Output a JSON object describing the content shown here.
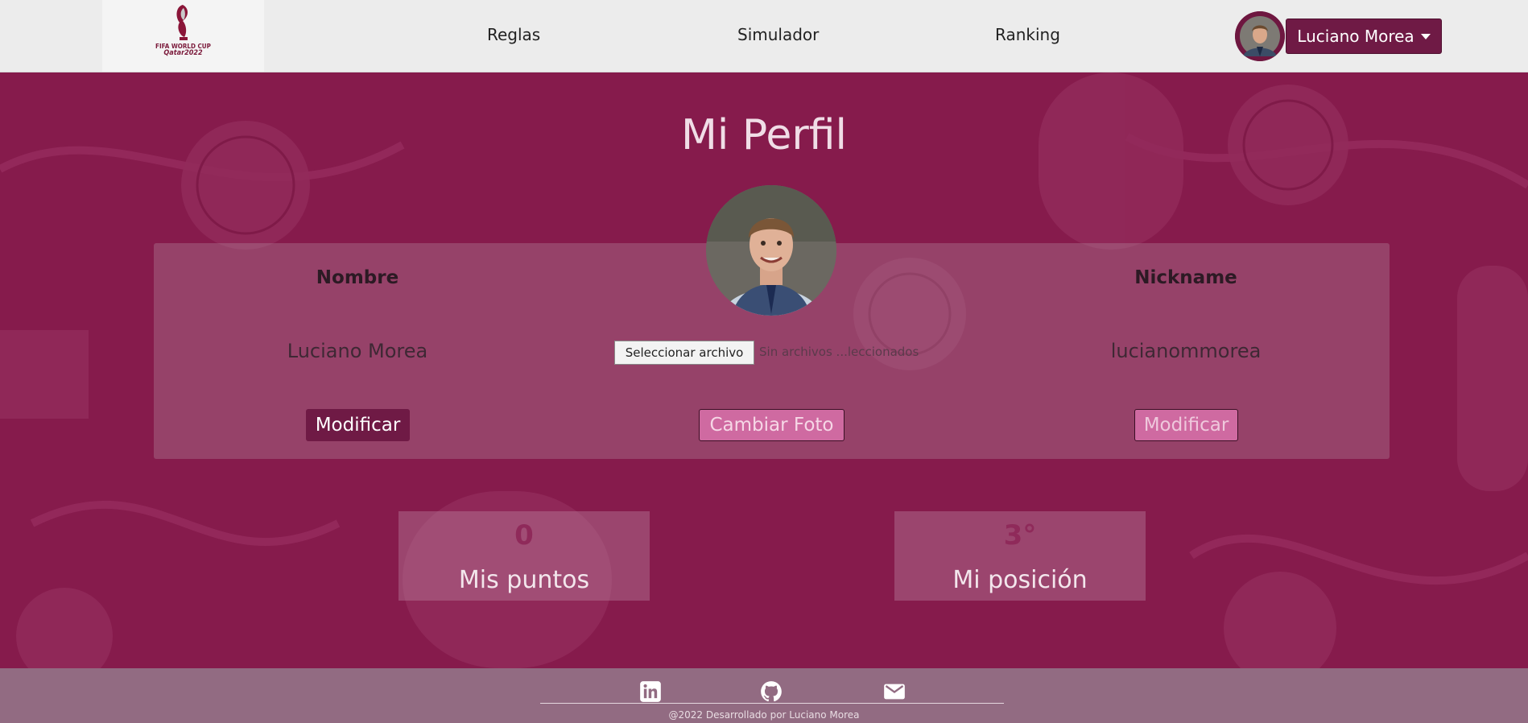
{
  "brand": {
    "logo_text_line1": "FIFA WORLD CUP",
    "logo_text_line2": "Qatar2022",
    "logo_icon": "world-cup-trophy-logo"
  },
  "nav": {
    "links": [
      {
        "label": "Reglas"
      },
      {
        "label": "Simulador"
      },
      {
        "label": "Ranking"
      }
    ],
    "user_name": "Luciano Morea",
    "user_avatar_icon": "user-avatar-photo",
    "caret_icon": "caret-down-icon"
  },
  "profile": {
    "title": "Mi Perfil",
    "name_header": "Nombre",
    "name_value": "Luciano Morea",
    "name_button": "Modificar",
    "file_button": "Seleccionar archivo",
    "file_status": "Sin archivos ...leccionados",
    "photo_button": "Cambiar Foto",
    "nickname_header": "Nickname",
    "nickname_value": "lucianommorea",
    "nickname_button": "Modificar"
  },
  "stats": {
    "points_value": "0",
    "points_label": "Mis puntos",
    "position_value": "3°",
    "position_label": "Mi posición"
  },
  "footer": {
    "icons": [
      "linkedin-icon",
      "github-icon",
      "email-icon"
    ],
    "copyright": "@2022 Desarrollado por Luciano Morea"
  },
  "colors": {
    "background": "#861b4c",
    "navbar": "#ececec",
    "primary_button": "#6f1a45",
    "accent_pink": "#cf6aa1",
    "footer": "#926b82"
  }
}
